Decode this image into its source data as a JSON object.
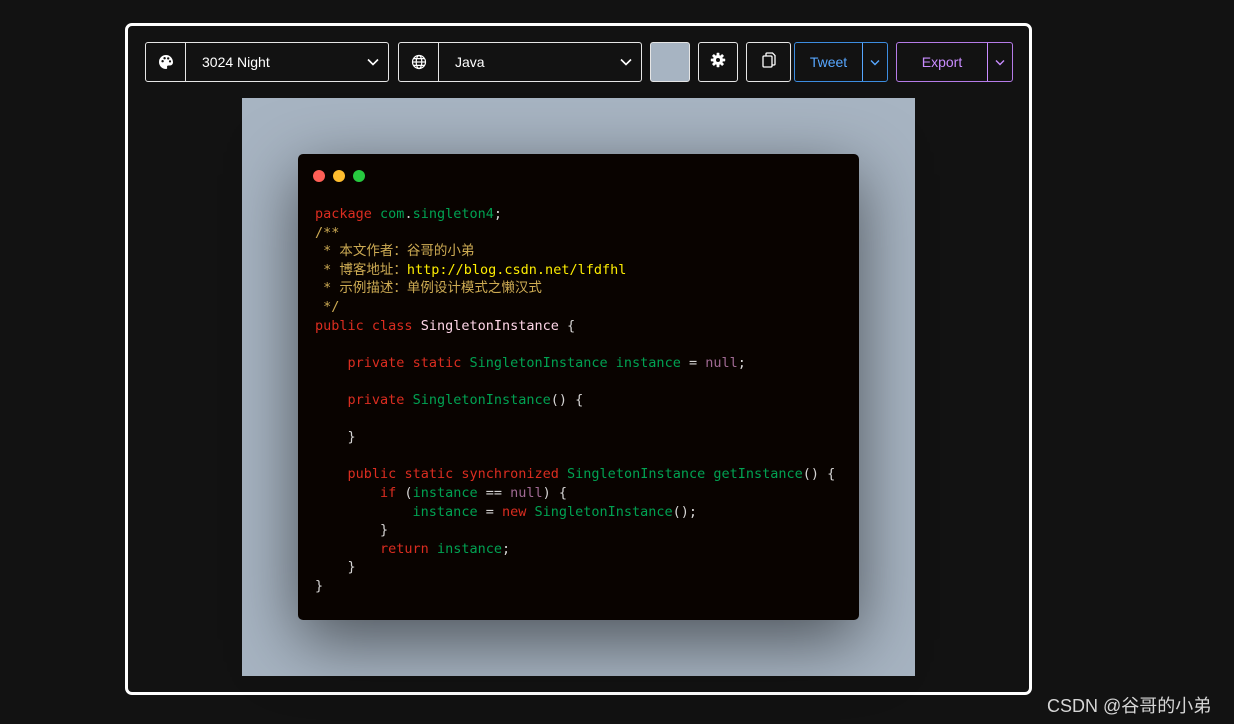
{
  "toolbar": {
    "theme": {
      "label": "3024 Night",
      "icon": "palette-icon"
    },
    "language": {
      "label": "Java",
      "icon": "globe-icon"
    },
    "background_color": "#a7b4c2",
    "settings_icon": "gear-icon",
    "copy_icon": "copy-icon",
    "tweet_label": "Tweet",
    "export_label": "Export"
  },
  "window": {
    "dot_colors": [
      "#ff5f56",
      "#ffbd2e",
      "#27c93f"
    ]
  },
  "code": {
    "lines": [
      [
        [
          "package",
          "kw"
        ],
        [
          " ",
          ""
        ],
        [
          "com",
          "grn"
        ],
        [
          ".",
          "pl"
        ],
        [
          "singleton4",
          "grn"
        ],
        [
          ";",
          "pl"
        ]
      ],
      [
        [
          "/**",
          "cm"
        ]
      ],
      [
        [
          " * 本文作者：谷哥的小弟",
          "cm"
        ]
      ],
      [
        [
          " * 博客地址：",
          "cm"
        ],
        [
          "http://blog.csdn.net/lfdfhl",
          "url"
        ]
      ],
      [
        [
          " * 示例描述：单例设计模式之懒汉式",
          "cm"
        ]
      ],
      [
        [
          " */",
          "cm"
        ]
      ],
      [
        [
          "public",
          "kw"
        ],
        [
          " ",
          ""
        ],
        [
          "class",
          "kw"
        ],
        [
          " ",
          ""
        ],
        [
          "SingletonInstance",
          "cls"
        ],
        [
          " {",
          "pl"
        ]
      ],
      [],
      [
        [
          "    ",
          ""
        ],
        [
          "private",
          "kw"
        ],
        [
          " ",
          ""
        ],
        [
          "static",
          "kw"
        ],
        [
          " ",
          ""
        ],
        [
          "SingletonInstance",
          "grn"
        ],
        [
          " ",
          ""
        ],
        [
          "instance",
          "grn"
        ],
        [
          " = ",
          "pl"
        ],
        [
          "null",
          "lit"
        ],
        [
          ";",
          "pl"
        ]
      ],
      [],
      [
        [
          "    ",
          ""
        ],
        [
          "private",
          "kw"
        ],
        [
          " ",
          ""
        ],
        [
          "SingletonInstance",
          "grn"
        ],
        [
          "() {",
          "pl"
        ]
      ],
      [],
      [
        [
          "    }",
          "pl"
        ]
      ],
      [],
      [
        [
          "    ",
          ""
        ],
        [
          "public",
          "kw"
        ],
        [
          " ",
          ""
        ],
        [
          "static",
          "kw"
        ],
        [
          " ",
          ""
        ],
        [
          "synchronized",
          "kw"
        ],
        [
          " ",
          ""
        ],
        [
          "SingletonInstance",
          "grn"
        ],
        [
          " ",
          ""
        ],
        [
          "getInstance",
          "grn"
        ],
        [
          "() {",
          "pl"
        ]
      ],
      [
        [
          "        ",
          ""
        ],
        [
          "if",
          "kw"
        ],
        [
          " (",
          "pl"
        ],
        [
          "instance",
          "grn"
        ],
        [
          " == ",
          "pl"
        ],
        [
          "null",
          "lit"
        ],
        [
          ") {",
          "pl"
        ]
      ],
      [
        [
          "            ",
          ""
        ],
        [
          "instance",
          "grn"
        ],
        [
          " = ",
          "pl"
        ],
        [
          "new",
          "kw"
        ],
        [
          " ",
          ""
        ],
        [
          "SingletonInstance",
          "grn"
        ],
        [
          "();",
          "pl"
        ]
      ],
      [
        [
          "        }",
          "pl"
        ]
      ],
      [
        [
          "        ",
          ""
        ],
        [
          "return",
          "kw"
        ],
        [
          " ",
          ""
        ],
        [
          "instance",
          "grn"
        ],
        [
          ";",
          "pl"
        ]
      ],
      [
        [
          "    }",
          "pl"
        ]
      ],
      [
        [
          "}",
          "pl"
        ]
      ]
    ],
    "colors": {
      "kw": "#db2d20",
      "grn": "#01a252",
      "pl": "#d6d5d4",
      "cm": "#cdab53",
      "url": "#fded02",
      "cls": "#ffd6e8",
      "lit": "#a16a94"
    }
  },
  "watermark": "CSDN @谷哥的小弟"
}
